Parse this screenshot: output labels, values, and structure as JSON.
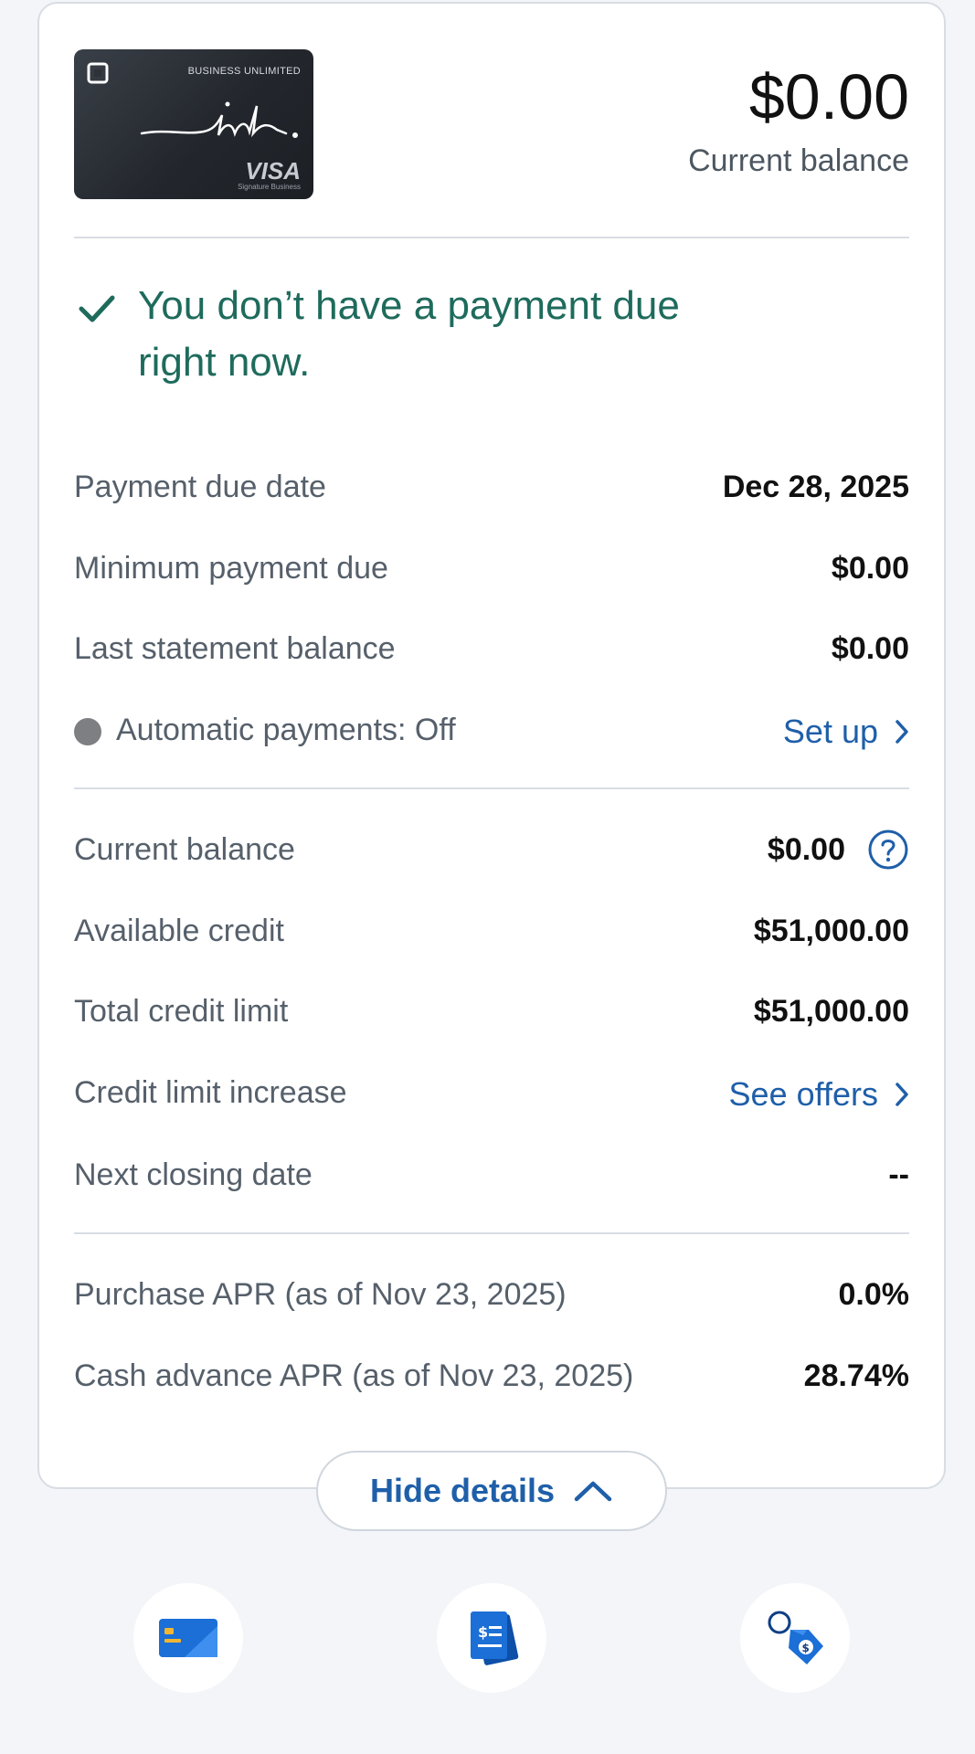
{
  "card": {
    "image_top_text": "BUSINESS UNLIMITED",
    "image_brand": "VISA",
    "image_sub": "Signature Business",
    "balance_amount": "$0.00",
    "balance_label": "Current balance"
  },
  "message": "You don’t have a payment due right now.",
  "payment_rows": [
    {
      "label": "Payment due date",
      "value": "Dec 28, 2025"
    },
    {
      "label": "Minimum payment due",
      "value": "$0.00"
    },
    {
      "label": "Last statement balance",
      "value": "$0.00"
    }
  ],
  "autopay": {
    "label": "Automatic payments: Off",
    "link": "Set up"
  },
  "balance_rows": {
    "current_balance": {
      "label": "Current balance",
      "value": "$0.00"
    },
    "available_credit": {
      "label": "Available credit",
      "value": "$51,000.00"
    },
    "total_credit_limit": {
      "label": "Total credit limit",
      "value": "$51,000.00"
    },
    "credit_limit_increase": {
      "label": "Credit limit increase",
      "link": "See offers"
    },
    "next_closing_date": {
      "label": "Next closing date",
      "value": "--"
    }
  },
  "apr_rows": [
    {
      "label": "Purchase APR (as of Nov 23, 2025)",
      "value": "0.0%"
    },
    {
      "label": "Cash advance APR (as of Nov 23, 2025)",
      "value": "28.74%"
    }
  ],
  "hide_details_label": "Hide details",
  "bottom_actions": [
    {
      "icon": "credit-card-icon"
    },
    {
      "icon": "statement-document-icon"
    },
    {
      "icon": "price-tag-offer-icon"
    }
  ],
  "colors": {
    "link_blue": "#1f5fa9",
    "success_green": "#1e6b5c",
    "icon_blue": "#1b6fd6",
    "background": "#f3f5f9"
  }
}
